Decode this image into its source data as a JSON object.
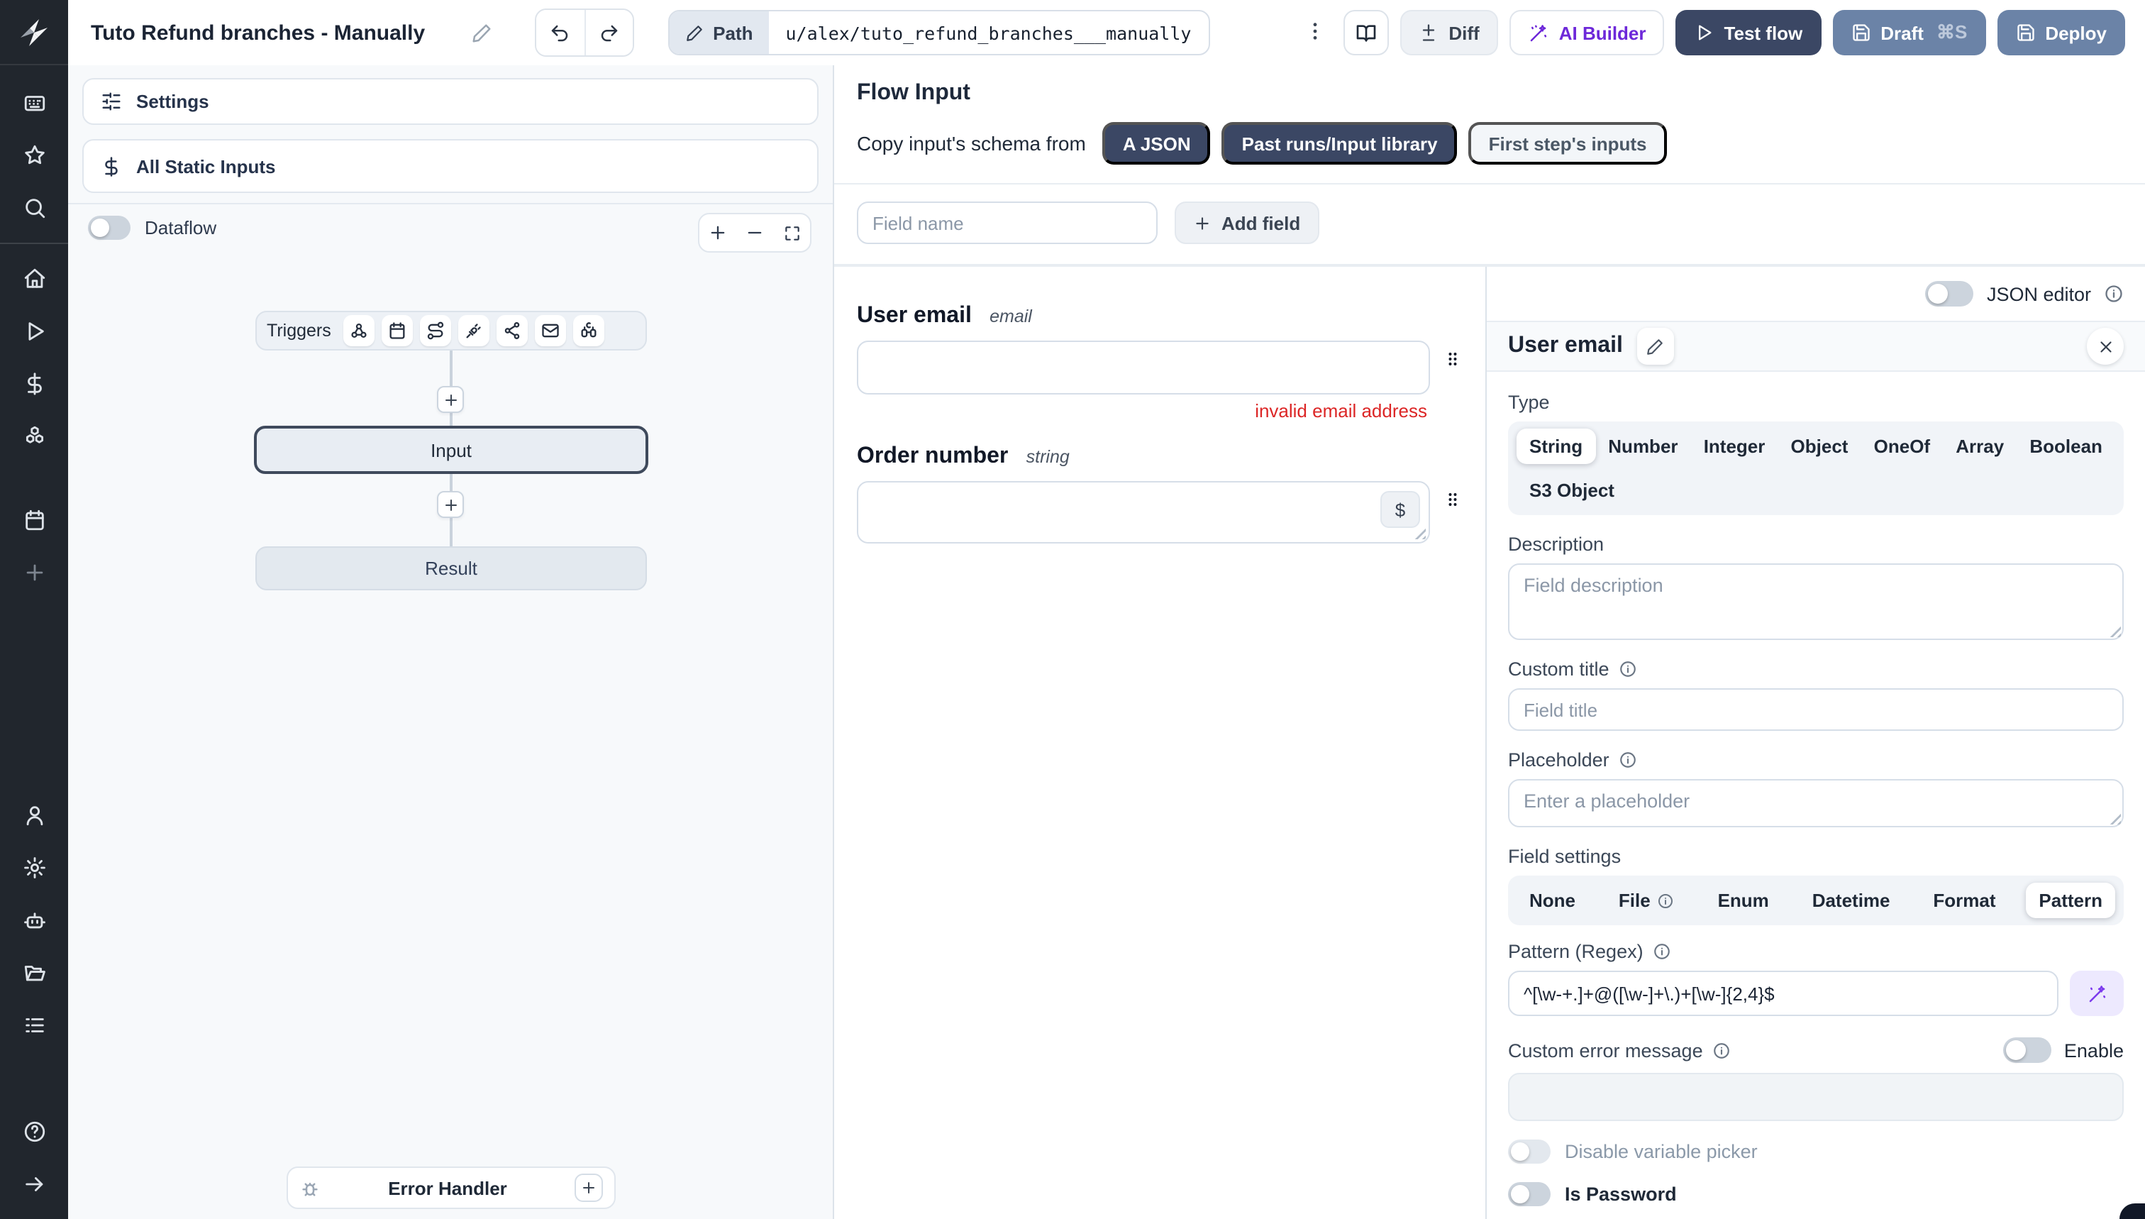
{
  "topbar": {
    "title": "Tuto Refund branches - Manually",
    "path_label": "Path",
    "path_value": "u/alex/tuto_refund_branches___manually",
    "diff_label": "Diff",
    "ai_builder_label": "AI Builder",
    "test_flow_label": "Test flow",
    "draft_label": "Draft",
    "draft_shortcut": "⌘S",
    "deploy_label": "Deploy",
    "icons": [
      "pencil-icon",
      "undo-icon",
      "redo-icon",
      "kebab-menu-icon",
      "docs-book-icon",
      "diff-icon",
      "wand-sparkles-icon",
      "play-icon",
      "save-icon"
    ]
  },
  "sidebar": {
    "icons": [
      "windmill-logo",
      "workspace-icon",
      "favorites-star-icon",
      "search-icon",
      "home-icon",
      "runs-play-icon",
      "variables-dollar-icon",
      "resources-boxes-icon",
      "schedules-calendar-icon",
      "create-plus-icon",
      "user-icon",
      "settings-gear-icon",
      "ai-robot-icon",
      "folders-icon",
      "logs-list-icon",
      "help-icon",
      "expand-arrow-icon"
    ]
  },
  "left_panel": {
    "settings_label": "Settings",
    "static_inputs_label": "All Static Inputs",
    "dataflow_label": "Dataflow",
    "graph": {
      "triggers_label": "Triggers",
      "trigger_icons": [
        "webhook-icon",
        "schedule-calendar-icon",
        "http-route-icon",
        "websocket-plug-icon",
        "kafka-icon",
        "email-icon",
        "scheduled-poll-binoculars-icon"
      ],
      "input_node_label": "Input",
      "result_node_label": "Result",
      "error_handler_label": "Error Handler"
    }
  },
  "flow_input": {
    "title": "Flow Input",
    "copy_schema_label": "Copy input's schema from",
    "copy_buttons": [
      "A JSON",
      "Past runs/Input library",
      "First step's inputs"
    ],
    "field_name_placeholder": "Field name",
    "add_field_label": "Add field",
    "fields": [
      {
        "name": "User email",
        "type": "email",
        "value": "",
        "error": "invalid email address"
      },
      {
        "name": "Order number",
        "type": "string",
        "value": ""
      }
    ]
  },
  "editor_panel": {
    "json_editor_label": "JSON editor",
    "selected_field_title": "User email",
    "type_label": "Type",
    "type_options": [
      "String",
      "Number",
      "Integer",
      "Object",
      "OneOf",
      "Array",
      "Boolean",
      "S3 Object"
    ],
    "selected_type": "String",
    "description_label": "Description",
    "description_placeholder": "Field description",
    "custom_title_label": "Custom title",
    "custom_title_placeholder": "Field title",
    "placeholder_label": "Placeholder",
    "placeholder_placeholder": "Enter a placeholder",
    "field_settings_label": "Field settings",
    "field_settings_options": [
      "None",
      "File",
      "Enum",
      "Datetime",
      "Format",
      "Pattern"
    ],
    "selected_field_setting": "Pattern",
    "pattern_label": "Pattern (Regex)",
    "pattern_value": "^[\\w-+.]+@([\\w-]+\\.)+[\\w-]{2,4}$",
    "custom_error_label": "Custom error message",
    "enable_label": "Enable",
    "disable_variable_picker_label": "Disable variable picker",
    "is_password_label": "Is Password"
  },
  "colors": {
    "navy_button": "#3b4764",
    "slate_button": "#6b83a7",
    "ai_purple": "#6d28d9",
    "error_red": "#dc2626",
    "sidebar_bg": "#21262d",
    "selected_node_border": "#3f4a5c"
  }
}
